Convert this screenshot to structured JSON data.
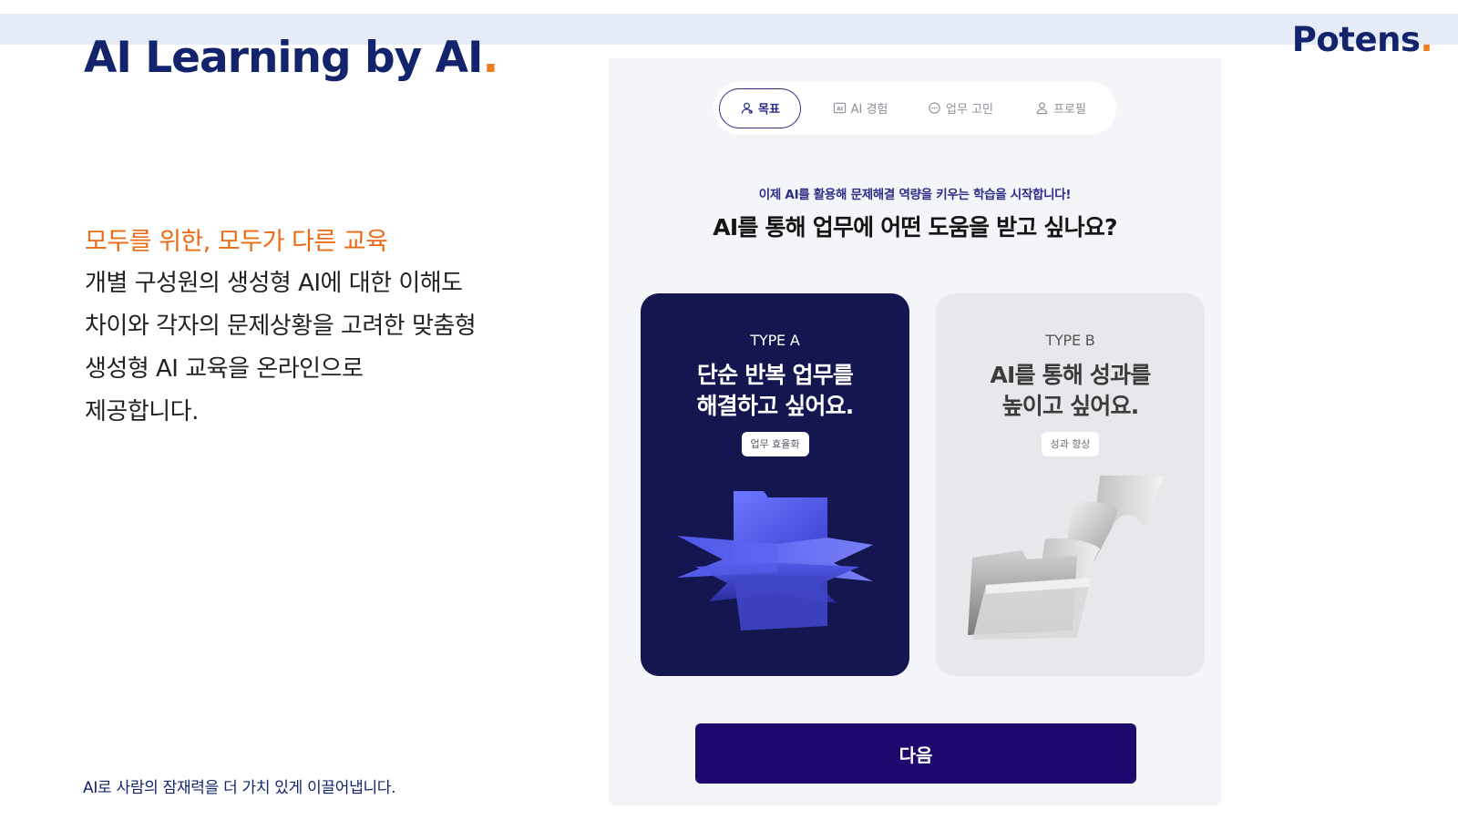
{
  "slide": {
    "title_main": "AI Learning by AI",
    "title_dot": ".",
    "brand_main": "Potens",
    "brand_dot": ".",
    "subhead": "모두를 위한, 모두가 다른 교육",
    "description_lines": [
      "개별 구성원의 생성형 AI에 대한 이해도",
      "차이와 각자의 문제상황을 고려한 맞춤형",
      "생성형 AI 교육을 온라인으로",
      "제공합니다."
    ],
    "footer_tagline": "AI로 사람의 잠재력을 더 가치 있게 이끌어냅니다."
  },
  "app": {
    "tabs": [
      {
        "label": "목표",
        "icon": "user-goal-icon",
        "active": true
      },
      {
        "label": "AI 경험",
        "icon": "ai-box-icon",
        "active": false
      },
      {
        "label": "업무 고민",
        "icon": "chat-bubble-icon",
        "active": false
      },
      {
        "label": "프로필",
        "icon": "person-icon",
        "active": false
      }
    ],
    "intro": "이제 AI를 활용해 문제해결 역량을 키우는 학습을 시작합니다!",
    "question": "AI를 통해 업무에 어떤 도움을 받고 싶나요?",
    "cards": [
      {
        "type_label": "TYPE A",
        "title_lines": [
          "단순 반복 업무를",
          "해결하고 싶어요."
        ],
        "badge": "업무 효율화",
        "selected": true,
        "illustration": "blue-folders-illustration"
      },
      {
        "type_label": "TYPE B",
        "title_lines": [
          "AI를 통해 성과를",
          "높이고 싶어요."
        ],
        "badge": "성과 향상",
        "selected": false,
        "illustration": "gray-folder-papers-illustration"
      }
    ],
    "next_label": "다음"
  },
  "colors": {
    "navy": "#14246c",
    "accent_orange": "#f07a1e",
    "card_a_bg": "#141650",
    "card_b_bg": "#e7e8eb",
    "button_bg": "#1e0a6e",
    "panel_bg": "#f4f5f9"
  }
}
